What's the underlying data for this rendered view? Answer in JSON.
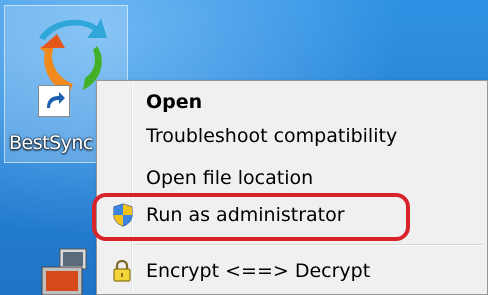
{
  "desktop": {
    "shortcut": {
      "label": "BestSync",
      "icon": "bestsync-sync-arrows-icon",
      "overlay_icon": "shortcut-arrow-icon"
    }
  },
  "context_menu": {
    "items": [
      {
        "label": "Open",
        "bold": true
      },
      {
        "label": "Troubleshoot compatibility"
      },
      {
        "label": "Open file location"
      },
      {
        "label": "Run as administrator",
        "icon": "uac-shield-icon"
      },
      {
        "label": "Encrypt <==> Decrypt",
        "icon": "padlock-icon"
      }
    ]
  },
  "annotation": {
    "color": "#d8232a"
  }
}
